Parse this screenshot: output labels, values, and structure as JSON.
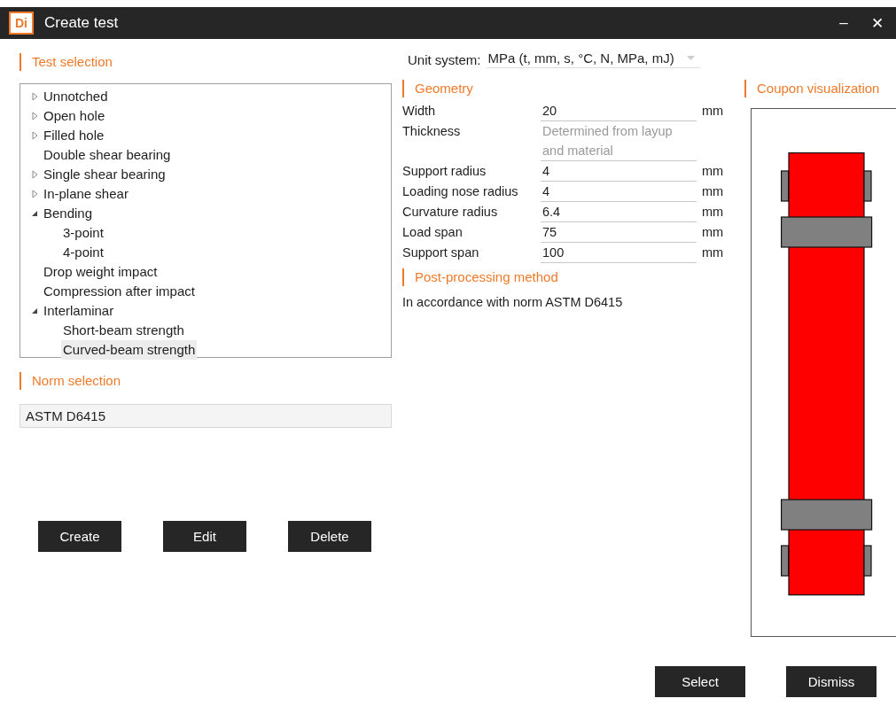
{
  "window": {
    "title": "Create test",
    "logo": "Di",
    "minimize": "–",
    "close": "✕"
  },
  "test_selection": {
    "heading": "Test selection",
    "tree": [
      {
        "label": "Unnotched",
        "kind": "branch",
        "expanded": false,
        "selected": false
      },
      {
        "label": "Open hole",
        "kind": "branch",
        "expanded": false,
        "selected": false
      },
      {
        "label": "Filled hole",
        "kind": "branch",
        "expanded": false,
        "selected": false
      },
      {
        "label": "Double shear bearing",
        "kind": "leaf",
        "selected": false
      },
      {
        "label": "Single shear bearing",
        "kind": "branch",
        "expanded": false,
        "selected": false
      },
      {
        "label": "In-plane shear",
        "kind": "branch",
        "expanded": false,
        "selected": false
      },
      {
        "label": "Bending",
        "kind": "branch",
        "expanded": true,
        "selected": false,
        "children": [
          {
            "label": "3-point",
            "kind": "leaf",
            "selected": false
          },
          {
            "label": "4-point",
            "kind": "leaf",
            "selected": false
          }
        ]
      },
      {
        "label": "Drop weight impact",
        "kind": "leaf",
        "selected": false
      },
      {
        "label": "Compression after impact",
        "kind": "leaf",
        "selected": false
      },
      {
        "label": "Interlaminar",
        "kind": "branch",
        "expanded": true,
        "selected": false,
        "children": [
          {
            "label": "Short-beam strength",
            "kind": "leaf",
            "selected": false
          },
          {
            "label": "Curved-beam strength",
            "kind": "leaf",
            "selected": true
          }
        ]
      }
    ]
  },
  "norm_selection": {
    "heading": "Norm selection",
    "value": "ASTM D6415"
  },
  "actions": [
    "Create",
    "Edit",
    "Delete"
  ],
  "unit_system": {
    "label": "Unit system:",
    "value": "MPa (t, mm, s, °C, N, MPa, mJ)"
  },
  "geometry": {
    "heading": "Geometry",
    "rows": [
      {
        "label": "Width",
        "kind": "input",
        "value": "20",
        "unit": "mm"
      },
      {
        "label": "Thickness",
        "kind": "derived",
        "value": "Determined from layup and material"
      },
      {
        "label": "Support radius",
        "kind": "input",
        "value": "4",
        "unit": "mm"
      },
      {
        "label": "Loading nose radius",
        "kind": "input",
        "value": "4",
        "unit": "mm"
      },
      {
        "label": "Curvature radius",
        "kind": "input",
        "value": "6.4",
        "unit": "mm"
      },
      {
        "label": "Load span",
        "kind": "input",
        "value": "75",
        "unit": "mm"
      },
      {
        "label": "Support span",
        "kind": "input",
        "value": "100",
        "unit": "mm"
      }
    ]
  },
  "post_processing": {
    "heading": "Post-processing method",
    "text": "In accordance with norm ASTM D6415"
  },
  "coupon": {
    "heading": "Coupon visualization"
  },
  "footer_buttons": [
    "Select",
    "Dismiss"
  ]
}
